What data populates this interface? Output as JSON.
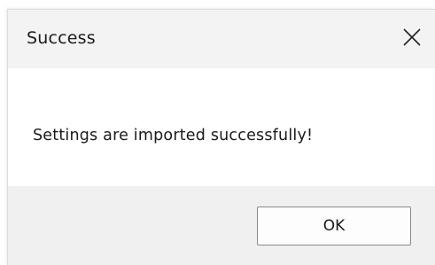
{
  "dialog": {
    "title": "Success",
    "close_icon": "close-icon",
    "message": "Settings are imported successfully!",
    "ok_label": "OK"
  },
  "colors": {
    "titlebar_bg": "#f3f3f3",
    "content_bg": "#ffffff",
    "footer_bg": "#f0f0f0",
    "button_border": "#8a8a8a"
  }
}
